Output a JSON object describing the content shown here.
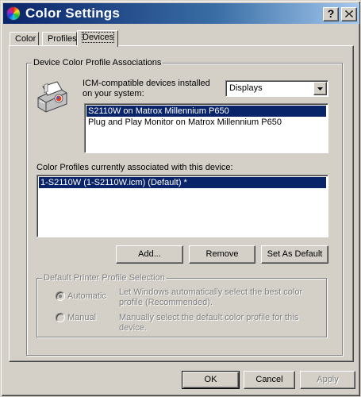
{
  "window": {
    "title": "Color Settings",
    "help_glyph": "?",
    "icons": {
      "app": "color-wheel-icon",
      "close": "close-icon",
      "help": "help-icon"
    }
  },
  "tabs": [
    {
      "label": "Color",
      "active": false
    },
    {
      "label": "Profiles",
      "active": false
    },
    {
      "label": "Devices",
      "active": true
    }
  ],
  "devices": {
    "group_title": "Device Color Profile Associations",
    "printer_icon": "printer-icon",
    "installed_label": "ICM-compatible devices installed on your system:",
    "device_type": {
      "value": "Displays",
      "options": [
        "Displays"
      ]
    },
    "device_list": [
      {
        "label": "S2110W on Matrox Millennium P650",
        "selected": true
      },
      {
        "label": "Plug and Play Monitor on Matrox Millennium P650",
        "selected": false
      }
    ],
    "profiles_label": "Color Profiles currently associated with this device:",
    "profile_list": [
      {
        "label": "1-S2110W (1-S2110W.icm) (Default) *",
        "selected": true
      }
    ],
    "buttons": {
      "add": "Add...",
      "remove": "Remove",
      "set_default": "Set As Default"
    },
    "printer_selection": {
      "group_title": "Default Printer Profile Selection",
      "automatic": {
        "label": "Automatic",
        "description": "Let Windows automatically select the best color profile (Recommended).",
        "checked": true
      },
      "manual": {
        "label": "Manual",
        "description": "Manually select the default color profile for this device.",
        "checked": false
      }
    }
  },
  "footer": {
    "ok": "OK",
    "cancel": "Cancel",
    "apply": "Apply"
  },
  "colors": {
    "titlebar_start": "#0a246a",
    "titlebar_end": "#a6caf0",
    "selection": "#0a246a",
    "face": "#d4d0c8"
  }
}
